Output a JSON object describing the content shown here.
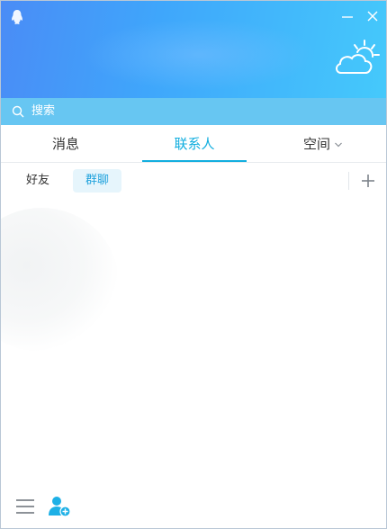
{
  "window": {
    "app_icon": "penguin-icon",
    "buttons": {
      "minimize_icon": "minimize-icon",
      "close_icon": "close-icon"
    },
    "weather_icon": "sun-cloud-icon"
  },
  "search": {
    "placeholder": "搜索",
    "icon": "search-icon"
  },
  "tabs": [
    {
      "label": "消息",
      "active": false
    },
    {
      "label": "联系人",
      "active": true
    },
    {
      "label": "空间",
      "active": false,
      "icon": "chevron-down-icon"
    }
  ],
  "subtabs": [
    {
      "label": "好友",
      "active": false
    },
    {
      "label": "群聊",
      "active": true
    }
  ],
  "actions": {
    "add_icon": "plus-icon"
  },
  "footer": {
    "menu_icon": "hamburger-menu-icon",
    "add_friend_icon": "add-friend-icon"
  },
  "colors": {
    "accent": "#12aedf",
    "header_start": "#4a8cf6",
    "header_end": "#45c9fb",
    "search_bar": "#67c6f2",
    "subtab_active_bg": "#e6f5fc"
  }
}
